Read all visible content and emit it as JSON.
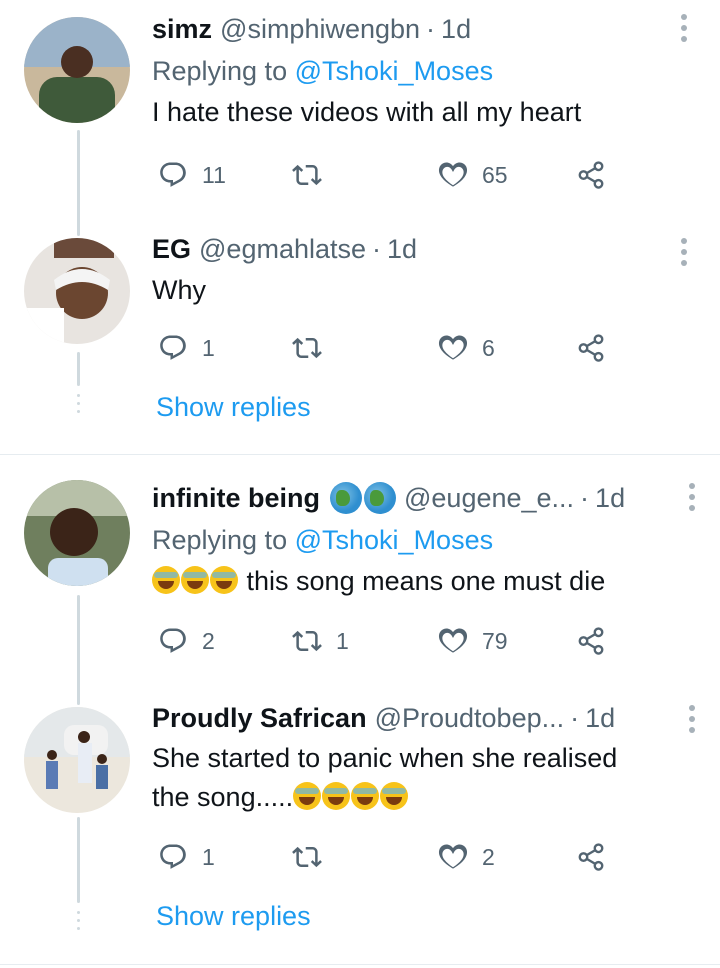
{
  "tweets": [
    {
      "name": "simz",
      "handle": "@simphiwengbn",
      "time": "1d",
      "replying_prefix": "Replying to",
      "replying_to": "@Tshoki_Moses",
      "text": "I hate these videos with all my heart",
      "replies": "11",
      "retweets": "",
      "likes": "65"
    },
    {
      "name": "EG",
      "handle": "@egmahlatse",
      "time": "1d",
      "text": "Why",
      "replies": "1",
      "retweets": "",
      "likes": "6",
      "show_replies": "Show replies"
    },
    {
      "name": "infinite being",
      "name_emoji": [
        "earth-africa-emoji",
        "earth-americas-emoji"
      ],
      "handle": "@eugene_e...",
      "time": "1d",
      "replying_prefix": "Replying to",
      "replying_to": "@Tshoki_Moses",
      "text_emoji": [
        "joy-emoji",
        "joy-emoji",
        "joy-emoji"
      ],
      "text": "this song means one must die",
      "replies": "2",
      "retweets": "1",
      "likes": "79"
    },
    {
      "name": "Proudly Safrican",
      "handle": "@Proudtobep...",
      "time": "1d",
      "text_line1": "She started to panic when she realised",
      "text_line2": "the song.....",
      "text_emoji": [
        "rofl-emoji",
        "rofl-emoji",
        "rofl-emoji",
        "rofl-emoji"
      ],
      "replies": "1",
      "retweets": "",
      "likes": "2",
      "show_replies": "Show replies"
    }
  ],
  "separator": "·",
  "colors": {
    "accent": "#1d9bf0",
    "text": "#0f1419",
    "muted": "#536471",
    "thread_line": "#cfd9de"
  }
}
